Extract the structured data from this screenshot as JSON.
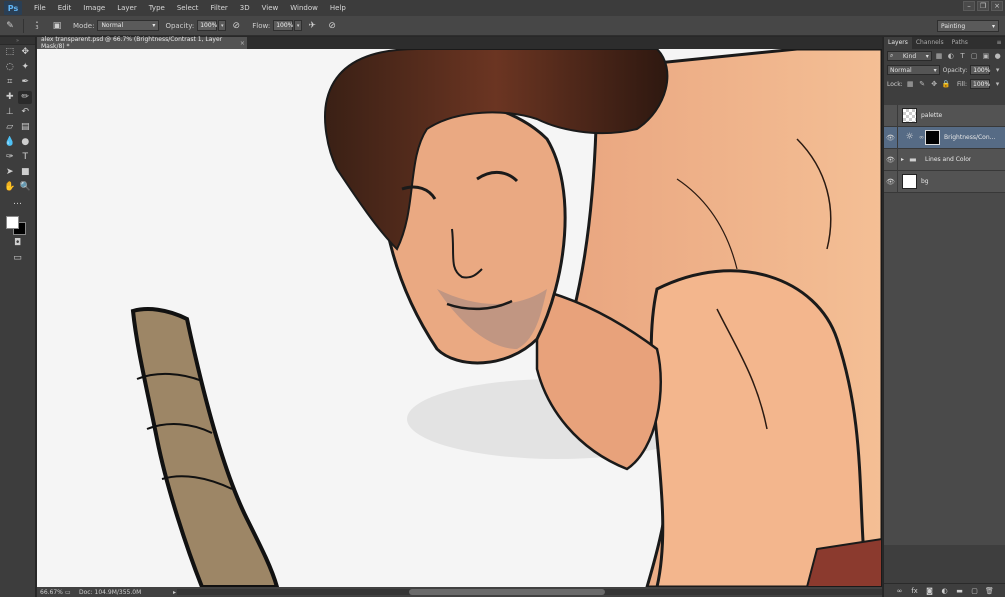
{
  "app": {
    "logo": "Ps"
  },
  "menu": [
    "File",
    "Edit",
    "Image",
    "Layer",
    "Type",
    "Select",
    "Filter",
    "3D",
    "View",
    "Window",
    "Help"
  ],
  "options": {
    "mode_label": "Mode:",
    "mode_value": "Normal",
    "opacity_label": "Opacity:",
    "opacity_value": "100%",
    "flow_label": "Flow:",
    "flow_value": "100%",
    "brush_size": "3"
  },
  "workspace": "Painting",
  "document": {
    "tab_title": "alex transparent.psd @ 66.7% (Brightness/Contrast 1, Layer Mask/8) *",
    "zoom": "66.67%",
    "doc_size": "Doc: 104.9M/355.0M"
  },
  "panel": {
    "tabs": [
      "Layers",
      "Channels",
      "Paths"
    ],
    "kind_value": "Kind",
    "blend_mode": "Normal",
    "opacity_label": "Opacity:",
    "opacity_value": "100%",
    "lock_label": "Lock:",
    "fill_label": "Fill:",
    "fill_value": "100%"
  },
  "layers": [
    {
      "name": "palette",
      "visible": false,
      "selected": false,
      "type": "pixel"
    },
    {
      "name": "Brightness/Con...",
      "visible": true,
      "selected": true,
      "type": "adjustment"
    },
    {
      "name": "Lines and Color",
      "visible": true,
      "selected": false,
      "type": "group"
    },
    {
      "name": "bg",
      "visible": true,
      "selected": false,
      "type": "pixel"
    }
  ],
  "colors": {
    "foreground": "#ffffff",
    "background": "#000000",
    "selection": "#566b85",
    "skin": "#f2b78e",
    "hair": "#4a2a1c",
    "staff": "#9d8666"
  },
  "icons": {
    "eye": "eye-icon",
    "adjustment": "brightness-icon",
    "folder": "folder-icon",
    "chain": "chain-link-icon"
  }
}
